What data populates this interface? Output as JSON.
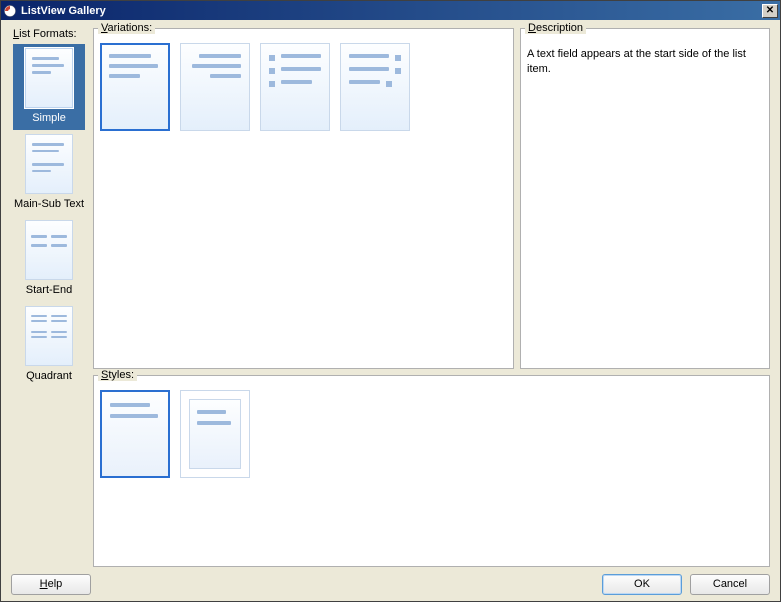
{
  "window": {
    "title": "ListView Gallery"
  },
  "labels": {
    "formats_prefix": "L",
    "formats_rest": "ist Formats:",
    "variations_prefix": "V",
    "variations_rest": "ariations:",
    "styles_prefix": "S",
    "styles_rest": "tyles:",
    "description_prefix": "D",
    "description_rest": "escription"
  },
  "formats": [
    {
      "id": "simple",
      "label": "Simple",
      "selected": true
    },
    {
      "id": "main-sub",
      "label": "Main-Sub Text",
      "selected": false
    },
    {
      "id": "start-end",
      "label": "Start-End",
      "selected": false
    },
    {
      "id": "quadrant",
      "label": "Quadrant",
      "selected": false
    }
  ],
  "variations": [
    {
      "id": "var1",
      "selected": true
    },
    {
      "id": "var2",
      "selected": false
    },
    {
      "id": "var3",
      "selected": false
    },
    {
      "id": "var4",
      "selected": false
    }
  ],
  "styles": [
    {
      "id": "style1",
      "selected": true
    },
    {
      "id": "style2",
      "selected": false
    }
  ],
  "description": {
    "text": "A text field appears at the start side of the list item."
  },
  "buttons": {
    "help_prefix": "H",
    "help_rest": "elp",
    "ok": "OK",
    "cancel": "Cancel"
  }
}
